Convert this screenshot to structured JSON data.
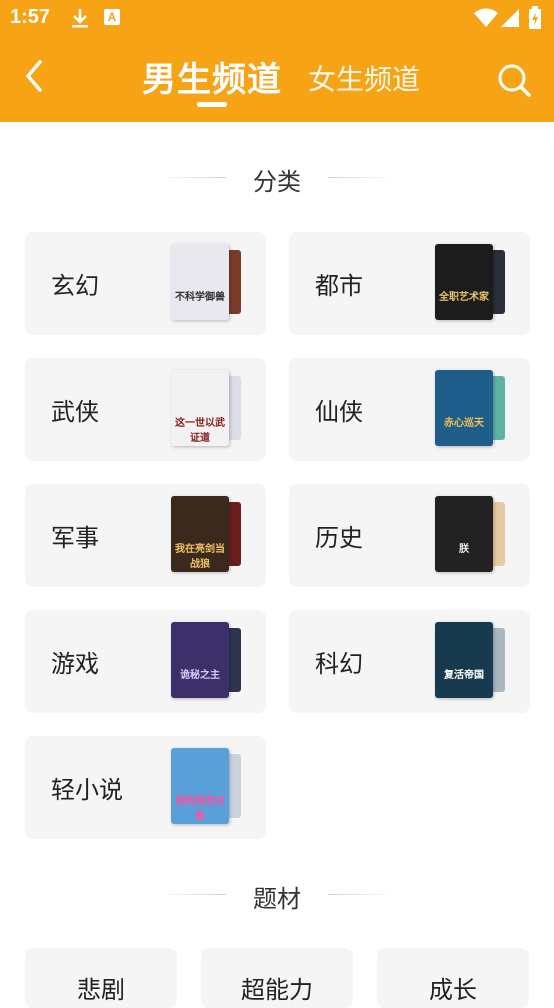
{
  "status": {
    "time": "1:57",
    "download_icon": "download-icon",
    "app_icon_letter": "A"
  },
  "nav": {
    "male_tab": "男生频道",
    "female_tab": "女生频道"
  },
  "sections": {
    "category": "分类",
    "theme": "题材"
  },
  "categories": [
    {
      "label": "玄幻",
      "cover_text": "不科学御兽",
      "cover_bg": "#E8E8EE",
      "cover_color": "#333333",
      "back_bg": "#7A3A2A"
    },
    {
      "label": "都市",
      "cover_text": "全职艺术家",
      "cover_bg": "#1C1C1C",
      "cover_color": "#E9C46A",
      "back_bg": "#2A2F3A"
    },
    {
      "label": "武侠",
      "cover_text": "这一世以武证道",
      "cover_bg": "#F2F2F2",
      "cover_color": "#8B1A1A",
      "back_bg": "#DDDDE8"
    },
    {
      "label": "仙侠",
      "cover_text": "赤心巡天",
      "cover_bg": "#1F5E8A",
      "cover_color": "#F3C24D",
      "back_bg": "#5FB3A2"
    },
    {
      "label": "军事",
      "cover_text": "我在亮剑当战狼",
      "cover_bg": "#3A2A1E",
      "cover_color": "#F0C060",
      "back_bg": "#6A1E1E"
    },
    {
      "label": "历史",
      "cover_text": "朕",
      "cover_bg": "#222222",
      "cover_color": "#EEEEEE",
      "back_bg": "#E8C9A0"
    },
    {
      "label": "游戏",
      "cover_text": "诡秘之主",
      "cover_bg": "#3C2F6A",
      "cover_color": "#D8CCF5",
      "back_bg": "#2E3550"
    },
    {
      "label": "科幻",
      "cover_text": "复活帝国",
      "cover_bg": "#173A4E",
      "cover_color": "#FFFFFF",
      "back_bg": "#A9B7C0"
    },
    {
      "label": "轻小说",
      "cover_text": "我的网恋对象",
      "cover_bg": "#5AA0D8",
      "cover_color": "#FF4FA3",
      "back_bg": "#C9D3DE"
    }
  ],
  "themes": [
    {
      "label": "悲剧"
    },
    {
      "label": "超能力"
    },
    {
      "label": "成长"
    }
  ],
  "colors": {
    "brand": "#F7A316",
    "card_bg": "#F5F5F5"
  }
}
